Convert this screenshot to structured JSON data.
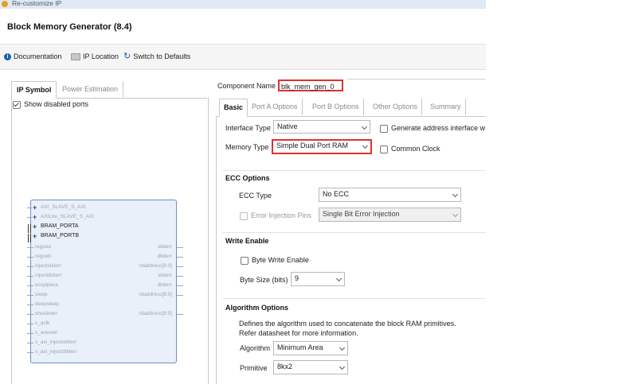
{
  "window": {
    "title": "Re-customize IP"
  },
  "header": {
    "ip_name": "Block Memory Generator (8.4)"
  },
  "toolbar": {
    "documentation": "Documentation",
    "ip_location": "IP Location",
    "switch_defaults": "Switch to Defaults"
  },
  "left": {
    "tabs": [
      {
        "label": "IP Symbol"
      },
      {
        "label": "Power Estimation"
      }
    ],
    "show_disabled": "Show disabled ports",
    "symbol": {
      "bus_left": [
        {
          "label": "AXI_SLAVE_S_AXI"
        },
        {
          "label": "AXILite_SLAVE_S_AXI"
        },
        {
          "label": "BRAM_PORTA"
        },
        {
          "label": "BRAM_PORTB"
        }
      ],
      "left_ports": [
        {
          "label": "regcea"
        },
        {
          "label": "regceb"
        },
        {
          "label": "injectsbiterr"
        },
        {
          "label": "injectdbiterr"
        },
        {
          "label": "eccpipece"
        },
        {
          "label": "sleep"
        },
        {
          "label": "deepsleep"
        },
        {
          "label": "shutdown"
        },
        {
          "label": "s_aclk"
        },
        {
          "label": "s_aresetn"
        },
        {
          "label": "s_axi_injectsbiterr"
        },
        {
          "label": "s_axi_injectdbiterr"
        }
      ],
      "right_ports": [
        {
          "label": "sbiterr"
        },
        {
          "label": "dbiterr"
        },
        {
          "label": "rdaddrecc[8:0]"
        },
        {
          "label": "sbiterr"
        },
        {
          "label": "dbiterr"
        },
        {
          "label": "rdaddrecc[8:0]"
        },
        {
          "label": "rdaddrecc[8:0]"
        }
      ]
    }
  },
  "right": {
    "component_name_label": "Component Name",
    "component_name": "blk_mem_gen_0",
    "tabs": [
      {
        "label": "Basic"
      },
      {
        "label": "Port A Options"
      },
      {
        "label": "Port B Options"
      },
      {
        "label": "Other Options"
      },
      {
        "label": "Summary"
      }
    ],
    "interface_type_label": "Interface Type",
    "interface_type": "Native",
    "generate_addr_label": "Generate address interface w",
    "memory_type_label": "Memory Type",
    "memory_type": "Simple Dual Port RAM",
    "common_clock_label": "Common Clock",
    "ecc_section": "ECC Options",
    "ecc_type_label": "ECC Type",
    "ecc_type": "No ECC",
    "error_injection_label": "Error Injection Pins",
    "error_injection": "Single Bit Error Injection",
    "write_enable_section": "Write Enable",
    "byte_write_label": "Byte Write Enable",
    "byte_size_label": "Byte Size (bits)",
    "byte_size": "9",
    "algorithm_section": "Algorithm Options",
    "algorithm_desc_1": "Defines the algorithm used to concatenate the block RAM primitives.",
    "algorithm_desc_2": "Refer datasheet for more information.",
    "algorithm_label": "Algorithm",
    "algorithm": "Minimum Area",
    "primitive_label": "Primitive",
    "primitive": "8kx2"
  }
}
